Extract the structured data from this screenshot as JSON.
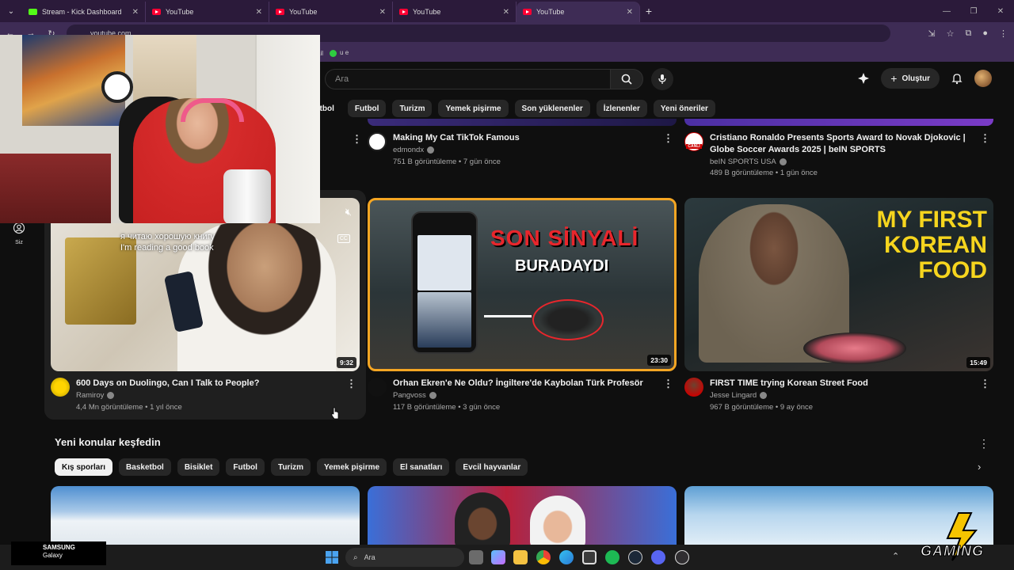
{
  "browser": {
    "tabs": [
      {
        "title": "Stream - Kick Dashboard",
        "icon": "kick-icon"
      },
      {
        "title": "YouTube",
        "icon": "youtube-icon"
      },
      {
        "title": "YouTube",
        "icon": "youtube-icon"
      },
      {
        "title": "YouTube",
        "icon": "youtube-icon"
      },
      {
        "title": "YouTube",
        "icon": "youtube-icon",
        "active": true
      }
    ],
    "url": "youtube.com",
    "bookmarks": [
      "ail",
      "u e"
    ]
  },
  "header": {
    "search_placeholder": "Ara",
    "create_label": "Oluştur"
  },
  "chips": {
    "top": [
      "etbol",
      "Futbol",
      "Turizm",
      "Yemek pişirme",
      "Son yüklenenler",
      "İzlenenler",
      "Yeni öneriler"
    ],
    "section": [
      "Kış sporları",
      "Basketbol",
      "Bisiklet",
      "Futbol",
      "Turizm",
      "Yemek pişirme",
      "El sanatları",
      "Evcil hayvanlar"
    ]
  },
  "sidebar": {
    "you_label": "Siz"
  },
  "videos_row1": [
    {
      "title": "Making My Cat TikTok Famous",
      "channel": "edmondx",
      "stats": "751 B görüntüleme • 7 gün önce"
    },
    {
      "title": "Cristiano Ronaldo Presents Sports Award to Novak Djokovic | Globe Soccer Awards 2025 | beIN SPORTS",
      "channel": "beIN SPORTS USA",
      "stats": "489 B görüntüleme • 1 gün önce",
      "avatar_text": "CANLI"
    }
  ],
  "videos_row2": [
    {
      "title": "600 Days on Duolingo, Can I Talk to People?",
      "channel": "Ramiroy",
      "stats": "4,4 Mn görüntüleme • 1 yıl önce",
      "duration": "9:32",
      "overlay_ru": "я читаю хорошую книгу",
      "overlay_en": "I'm reading a good book",
      "cc": "CC"
    },
    {
      "title": "Orhan Ekren'e Ne Oldu? İngiltere'de Kaybolan Türk Profesör",
      "channel": "Pangvoss",
      "stats": "117 B görüntüleme • 3 gün önce",
      "duration": "23:30",
      "overlay_1": "SON SİNYALİ",
      "overlay_2": "BURADAYDI"
    },
    {
      "title": "FIRST TIME trying Korean Street Food",
      "channel": "Jesse Lingard",
      "stats": "967 B görüntüleme • 9 ay önce",
      "duration": "15:49",
      "overlay_1": "MY FIRST",
      "overlay_2": "KOREAN FOOD"
    }
  ],
  "section": {
    "title": "Yeni konular keşfedin"
  },
  "taskbar": {
    "search_placeholder": "Ara",
    "device_brand": "SAMSUNG",
    "device_model": "Galaxy"
  },
  "overlay_logo": {
    "text": "GAMING"
  },
  "colors": {
    "youtube_red": "#ff0033",
    "kick_green": "#53fc18",
    "browser_frame": "#3e2c55",
    "thumb_border_orange": "#f5a623"
  }
}
